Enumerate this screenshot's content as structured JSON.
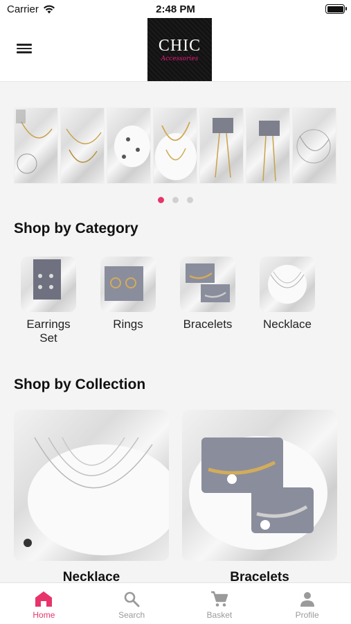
{
  "status_bar": {
    "carrier": "Carrier",
    "time": "2:48 PM"
  },
  "header": {
    "logo_main": "CHIC",
    "logo_sub": "Accessories"
  },
  "carousel": {
    "slide_count": 7,
    "page_count": 3,
    "active_page": 1
  },
  "category_section": {
    "title": "Shop by Category",
    "items": [
      {
        "label": "Earrings\nSet"
      },
      {
        "label": "Rings"
      },
      {
        "label": "Bracelets"
      },
      {
        "label": "Necklace"
      }
    ]
  },
  "collection_section": {
    "title": "Shop by Collection",
    "items": [
      {
        "label": "Necklace"
      },
      {
        "label": "Bracelets"
      }
    ]
  },
  "tabbar": {
    "tabs": [
      {
        "label": "Home",
        "icon": "home-icon",
        "active": true
      },
      {
        "label": "Search",
        "icon": "search-icon",
        "active": false
      },
      {
        "label": "Basket",
        "icon": "cart-icon",
        "active": false
      },
      {
        "label": "Profile",
        "icon": "profile-icon",
        "active": false
      }
    ]
  },
  "colors": {
    "accent": "#e8336a",
    "inactive": "#9a9a9a",
    "logo_bg": "#121212",
    "logo_pink": "#e4197a"
  }
}
